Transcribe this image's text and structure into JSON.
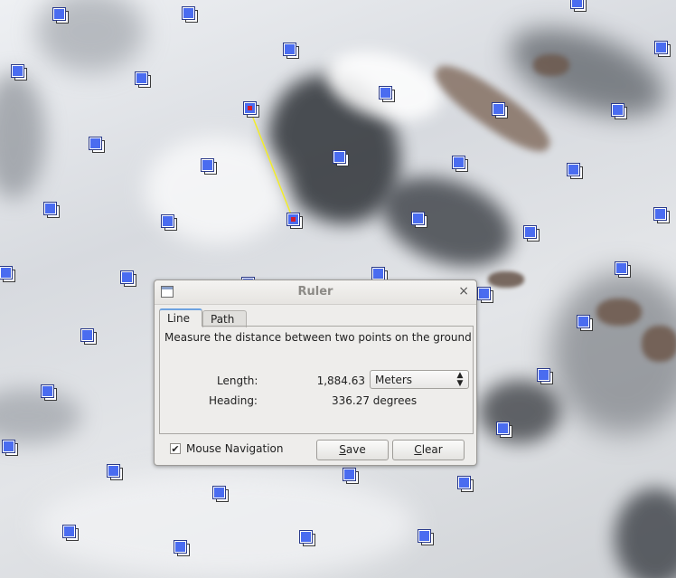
{
  "window": {
    "title": "Ruler",
    "close_glyph": "×",
    "icon": "window-icon"
  },
  "tabs": [
    {
      "label": "Line",
      "selected": true
    },
    {
      "label": "Path",
      "selected": false
    }
  ],
  "panel": {
    "description": "Measure the distance between two points on the ground",
    "length_label": "Length:",
    "length_value": "1,884.63",
    "units_selected": "Meters",
    "units_arrows": "⬆⬇",
    "heading_label": "Heading:",
    "heading_value": "336.27 degrees"
  },
  "mouse_navigation": {
    "label": "Mouse Navigation",
    "checked": true,
    "check_glyph": "✔"
  },
  "buttons": {
    "save_first": "S",
    "save_rest": "ave",
    "clear_first": "C",
    "clear_rest": "lear"
  },
  "colors": {
    "placemark_fill": "#4a6cf0",
    "measure_line": "#f2ec2a",
    "endpoint_marker": "#d21c2c",
    "tab_highlight": "#6da2e0"
  },
  "map": {
    "placemark_icon": "placemark-icon",
    "placemark_count": 50
  }
}
